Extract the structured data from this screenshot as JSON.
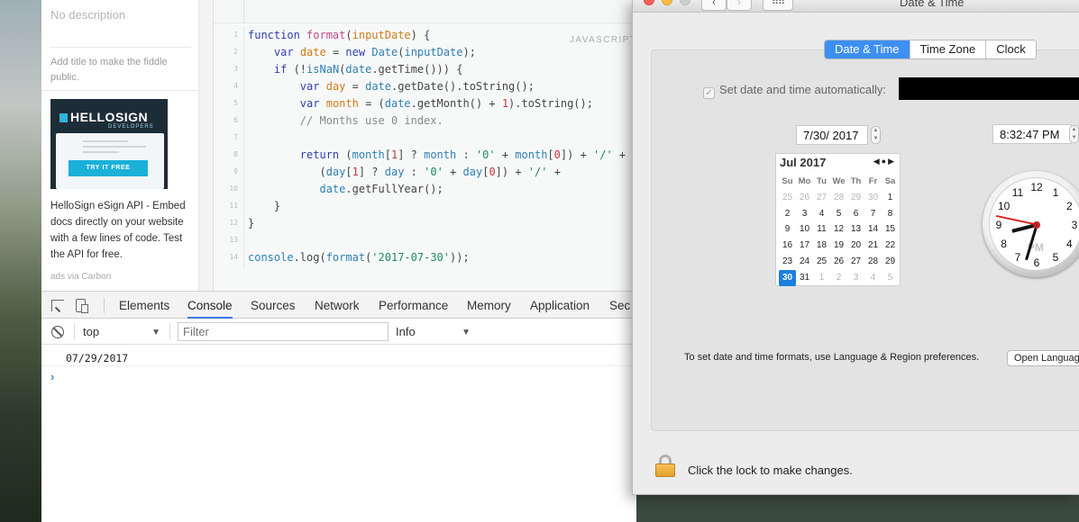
{
  "sidebar": {
    "description_placeholder": "No description",
    "add_title_hint": "Add title to make the fiddle public.",
    "ad": {
      "logo_text": "HELLOSIGN",
      "logo_sub": "DEVELOPERS",
      "cta": "TRY IT FREE",
      "text": "HelloSign eSign API - Embed docs directly on your website with a few lines of code. Test the API for free.",
      "via": "ads via Carbon"
    }
  },
  "editor": {
    "language_label": "JAVASCRIPT",
    "line_numbers": [
      "1",
      "2",
      "3",
      "4",
      "5",
      "6",
      "7",
      "8",
      "9",
      "10",
      "11",
      "12",
      "13",
      "14"
    ]
  },
  "devtools": {
    "tabs": [
      "Elements",
      "Console",
      "Sources",
      "Network",
      "Performance",
      "Memory",
      "Application",
      "Sec"
    ],
    "active_tab": "Console",
    "context": "top",
    "filter_placeholder": "Filter",
    "level": "Info",
    "output": "07/29/2017",
    "prompt_glyph": "›"
  },
  "prefs": {
    "title": "Date & Time",
    "nav_back": "‹",
    "nav_forward": "›",
    "grid_glyph": "⠿⠿",
    "segments": [
      "Date & Time",
      "Time Zone",
      "Clock"
    ],
    "selected_segment": "Date & Time",
    "auto_label": "Set date and time automatically:",
    "auto_checked": "✓",
    "date_value": "7/30/ 2017",
    "time_value": "8:32:47 PM",
    "calendar": {
      "month_label": "Jul 2017",
      "nav": "◀●▶",
      "weekdays": [
        "Su",
        "Mo",
        "Tu",
        "We",
        "Th",
        "Fr",
        "Sa"
      ],
      "weeks": [
        [
          "25",
          "26",
          "27",
          "28",
          "29",
          "30",
          "1"
        ],
        [
          "2",
          "3",
          "4",
          "5",
          "6",
          "7",
          "8"
        ],
        [
          "9",
          "10",
          "11",
          "12",
          "13",
          "14",
          "15"
        ],
        [
          "16",
          "17",
          "18",
          "19",
          "20",
          "21",
          "22"
        ],
        [
          "23",
          "24",
          "25",
          "26",
          "27",
          "28",
          "29"
        ],
        [
          "30",
          "31",
          "1",
          "2",
          "3",
          "4",
          "5"
        ]
      ],
      "selected_day": "30"
    },
    "clock": {
      "numbers": [
        "12",
        "1",
        "2",
        "3",
        "4",
        "5",
        "6",
        "7",
        "8",
        "9",
        "10",
        "11"
      ],
      "ampm": "PM",
      "time": "8:32:47"
    },
    "format_hint": "To set date and time formats, use Language & Region preferences.",
    "open_button": "Open Language & Region...",
    "lock_text": "Click the lock to make changes."
  },
  "colors": {
    "accent": "#3d8ff3",
    "calendar_selected": "#1d7fe0",
    "devtools_active": "#3b78e7"
  }
}
